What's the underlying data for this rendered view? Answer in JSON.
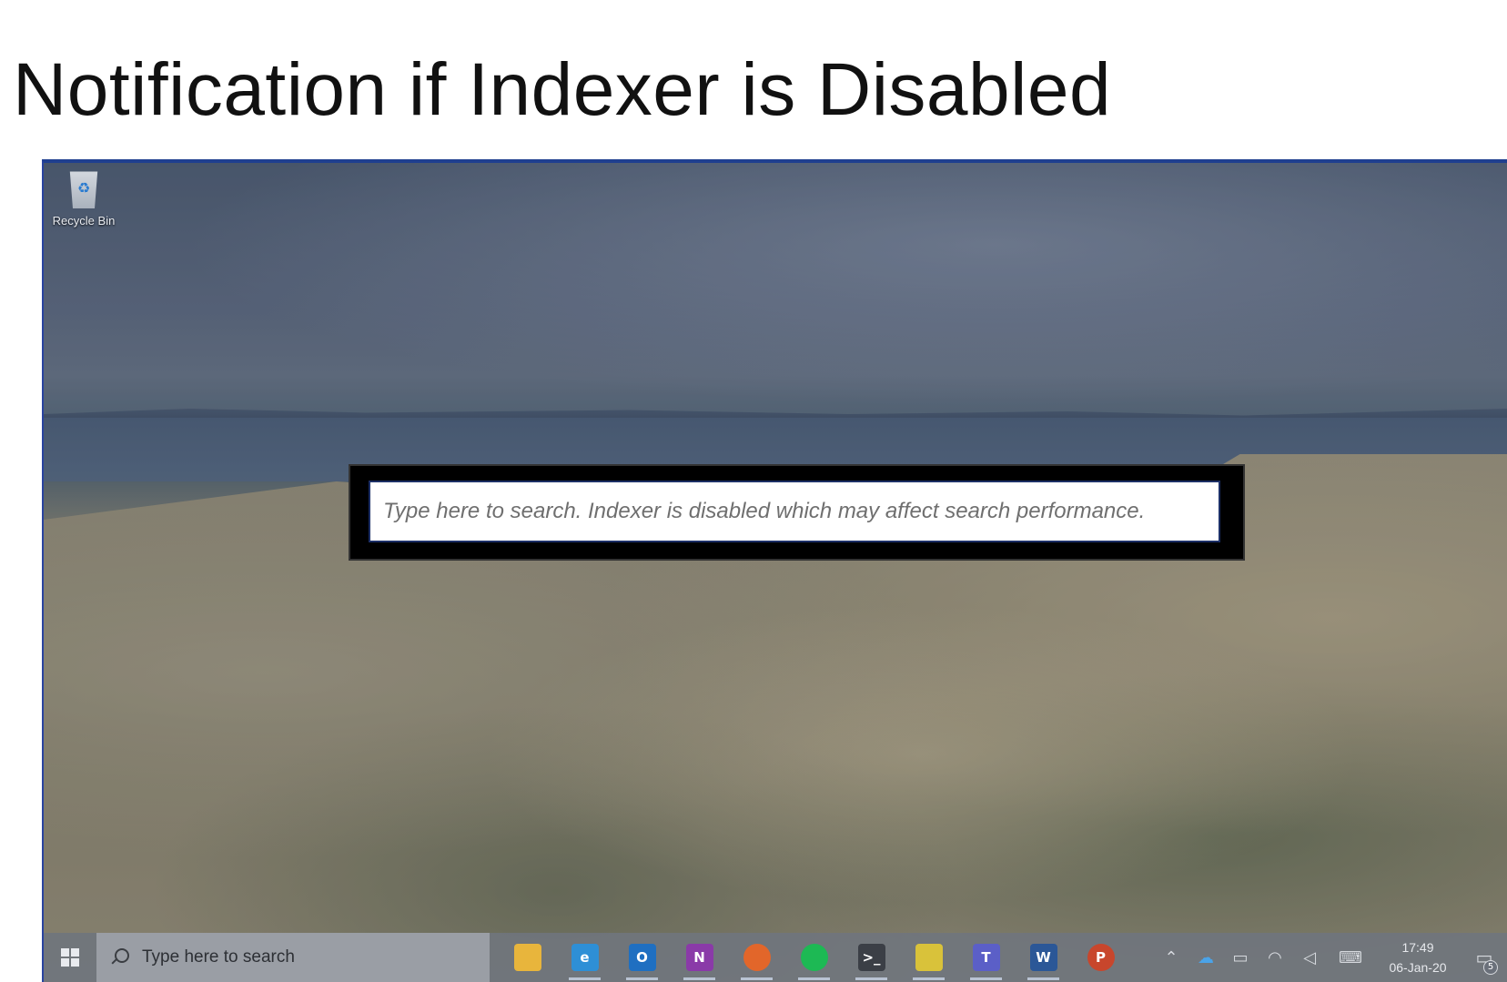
{
  "slide": {
    "title": "Notification if Indexer is Disabled"
  },
  "desktop": {
    "icons": [
      {
        "label": "Recycle Bin",
        "icon": "recycle-bin-icon"
      }
    ]
  },
  "search_overlay": {
    "text": "Type here to search. Indexer is disabled which may affect search performance."
  },
  "taskbar": {
    "start_icon": "windows-logo-icon",
    "search_placeholder": "Type here to search",
    "apps": [
      {
        "name": "file-explorer",
        "icon": "folder-icon",
        "color": "#e8b53c",
        "glyph": ""
      },
      {
        "name": "edge-beta",
        "icon": "edge-beta-icon",
        "color": "#2e8fd6",
        "glyph": "e"
      },
      {
        "name": "outlook",
        "icon": "outlook-icon",
        "color": "#1f6fc1",
        "glyph": "O"
      },
      {
        "name": "onenote",
        "icon": "onenote-icon",
        "color": "#8a3aa8",
        "glyph": "N"
      },
      {
        "name": "firefox",
        "icon": "firefox-icon",
        "color": "#e2662a",
        "glyph": ""
      },
      {
        "name": "spotify",
        "icon": "spotify-icon",
        "color": "#1db954",
        "glyph": ""
      },
      {
        "name": "terminal",
        "icon": "terminal-icon",
        "color": "#3b3f46",
        "glyph": ">_"
      },
      {
        "name": "sticky-notes",
        "icon": "sticky-notes-icon",
        "color": "#d9c23a",
        "glyph": ""
      },
      {
        "name": "teams",
        "icon": "teams-icon",
        "color": "#5b5fc7",
        "glyph": "T"
      },
      {
        "name": "word",
        "icon": "word-icon",
        "color": "#2b5797",
        "glyph": "W"
      },
      {
        "name": "powerpoint",
        "icon": "powerpoint-icon",
        "color": "#c8462c",
        "glyph": "P"
      }
    ],
    "tray": {
      "icons": [
        "chevron-up-icon",
        "onedrive-icon",
        "battery-icon",
        "wifi-icon",
        "volume-muted-icon",
        "keyboard-icon"
      ],
      "time": "17:49",
      "date": "06-Jan-20",
      "notification_count": "5"
    }
  }
}
